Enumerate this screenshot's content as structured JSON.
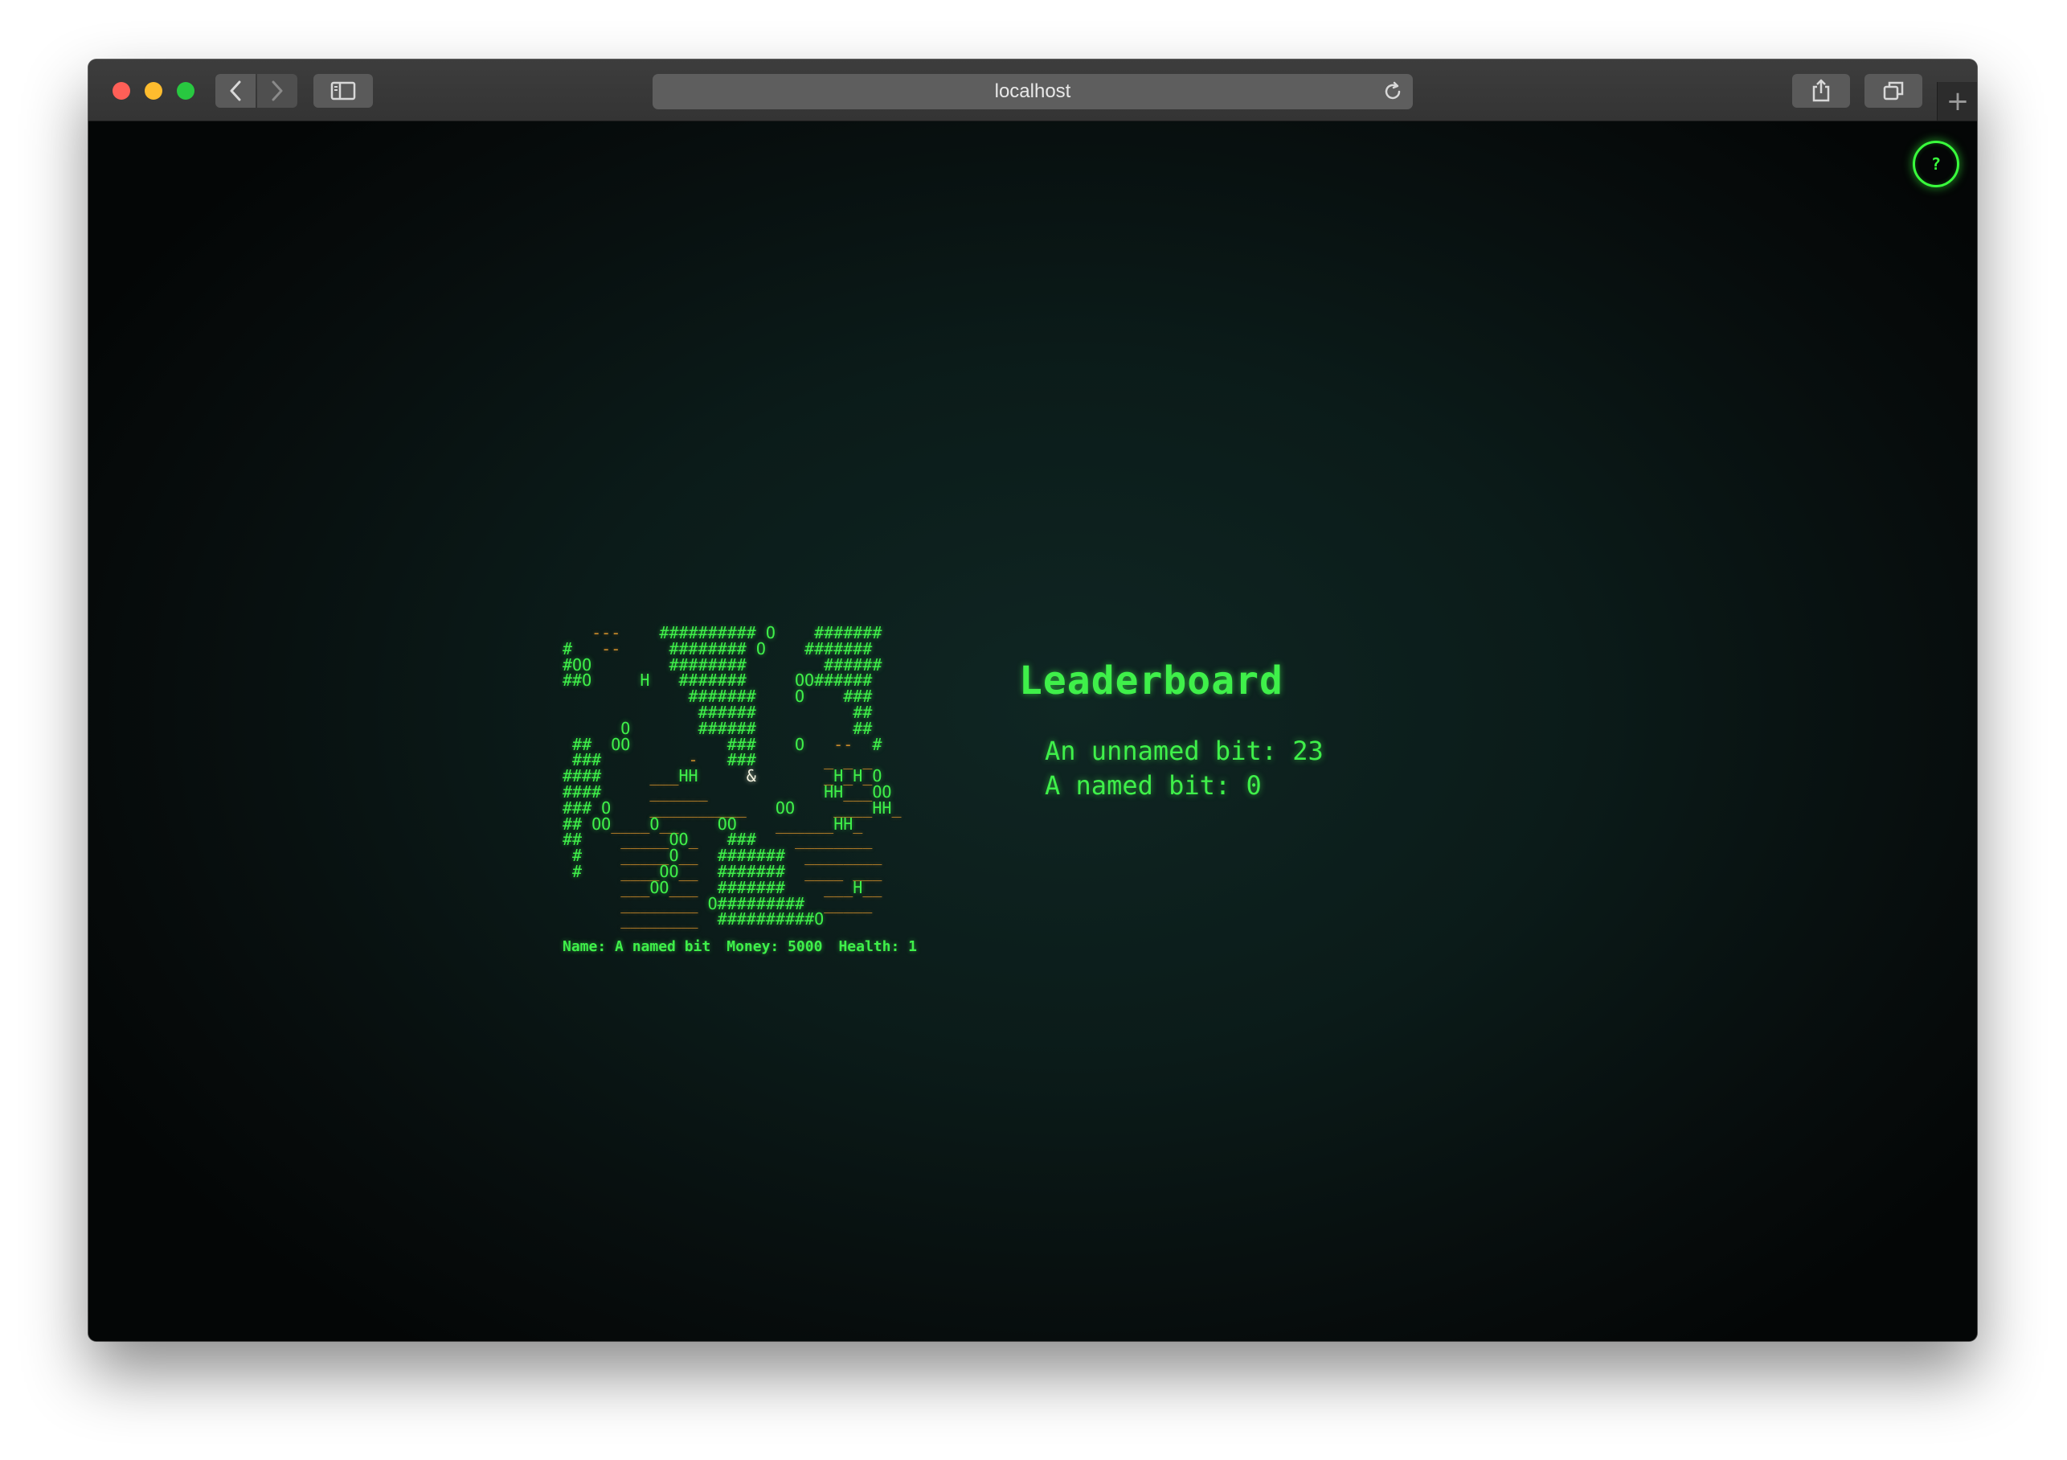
{
  "browser": {
    "url": "localhost"
  },
  "help": {
    "label": "?"
  },
  "map": {
    "rows": [
      "   ---    ########## O    #######",
      "#   --     ######## O    #######",
      "#OO        ########        ######",
      "##O     H   #######     OO######",
      "             #######    O    ###",
      "              ######          ##",
      "      O       ######          ##",
      " ##  OO          ###    O   --  #",
      " ###         -   ###       _ _ _",
      "####     ___HH     &       _H_H_O",
      "####     ______            HH___OO",
      "### O    __________   OO    ____HH_",
      "## OO____O__    OO    ______HH_",
      "##    _____OO_   ###    ________",
      " #    _____O__  #######  ________",
      " #    ____OO__  #######  ____ ___",
      "      ___OO___  #######    ___H__",
      "      ________ O#########  _____",
      "      ________  ##########O"
    ]
  },
  "status": {
    "name": "Name: A named bit",
    "money": "Money: 5000",
    "health": "Health: 1"
  },
  "leaderboard": {
    "title": "Leaderboard",
    "entries": [
      "An unnamed bit: 23",
      "A named bit: 0"
    ]
  },
  "colors": {
    "wall": "#3ff04a",
    "floor": "#c98a2a",
    "player": "#f2f2e0",
    "background": "#0b1b19"
  }
}
